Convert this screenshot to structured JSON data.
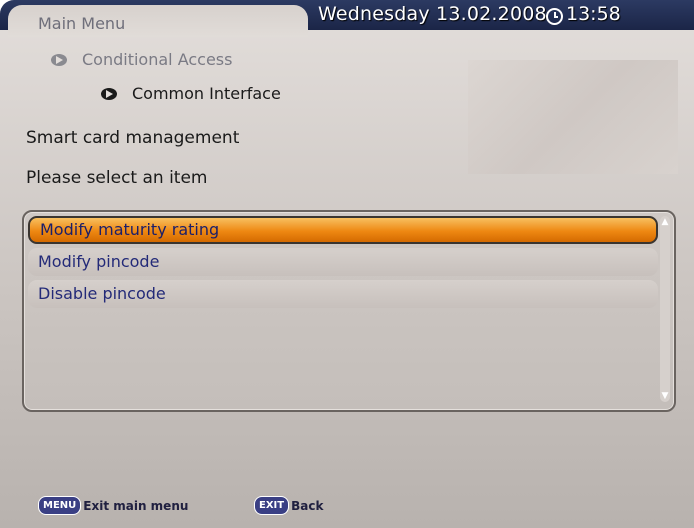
{
  "header": {
    "date": "Wednesday 13.02.2008",
    "time": "13:58"
  },
  "breadcrumb": {
    "main": "Main Menu",
    "level1": "Conditional Access",
    "level2": "Common Interface"
  },
  "section_title": "Smart card management",
  "prompt": "Please select an item",
  "list": {
    "items": [
      {
        "label": "Modify maturity rating",
        "selected": true
      },
      {
        "label": "Modify pincode",
        "selected": false
      },
      {
        "label": "Disable pincode",
        "selected": false
      }
    ]
  },
  "footer": {
    "menu_key": "MENU",
    "menu_label": "Exit main menu",
    "exit_key": "EXIT",
    "exit_label": "Back"
  }
}
